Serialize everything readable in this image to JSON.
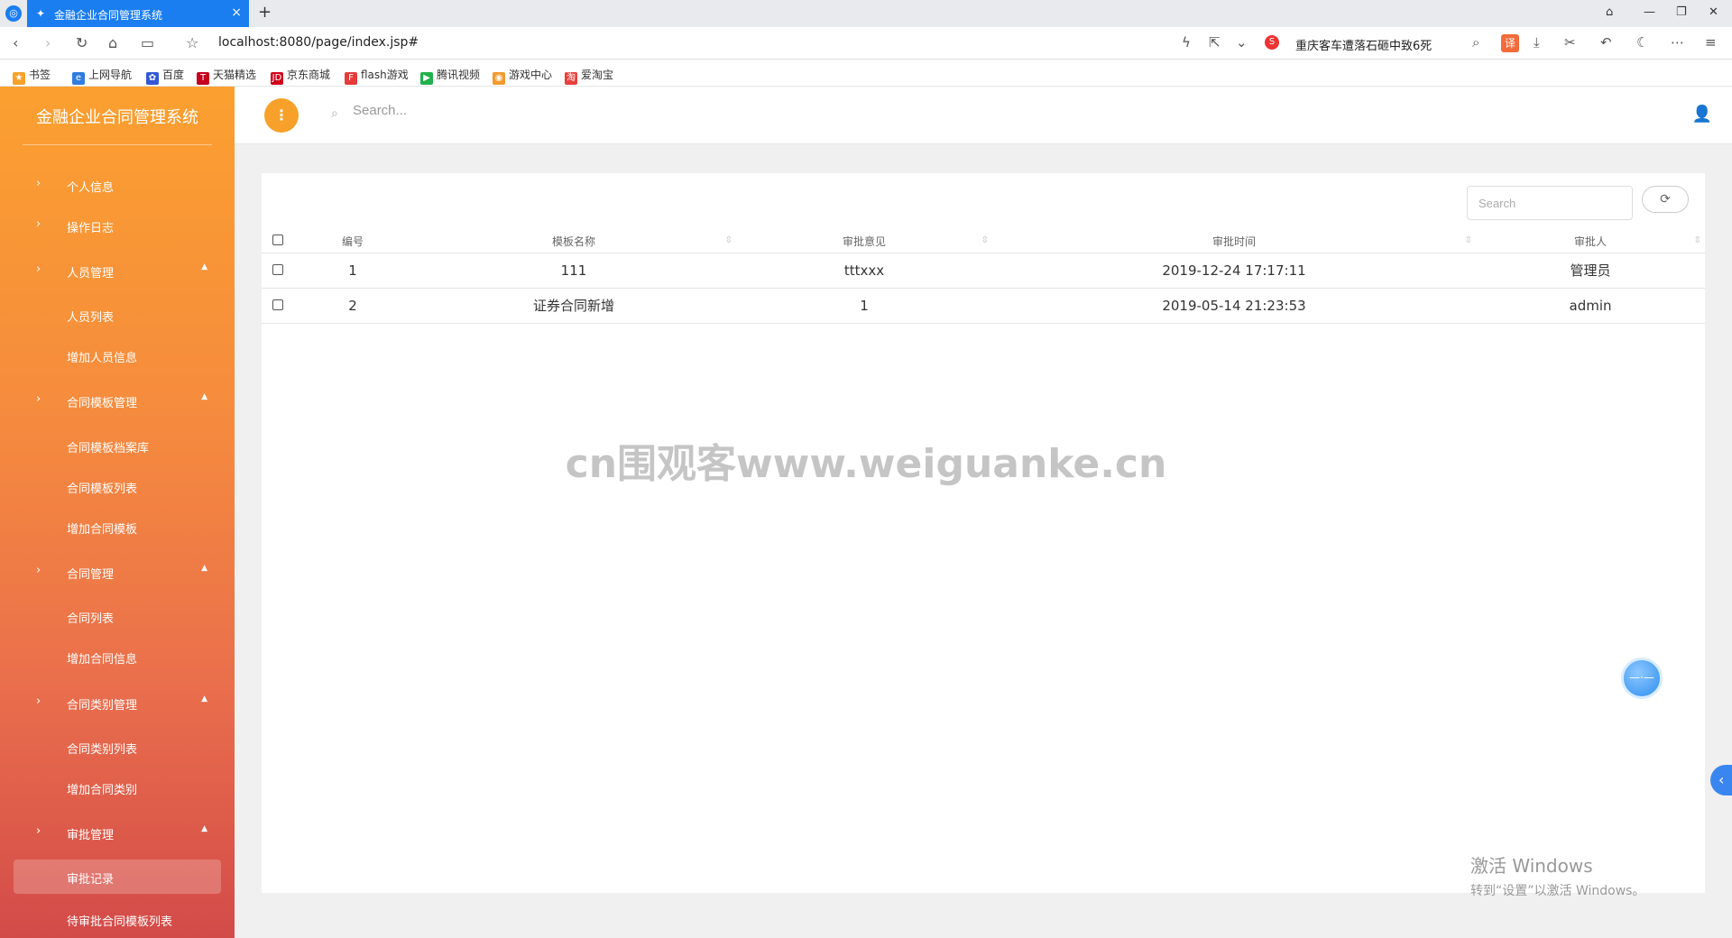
{
  "browser": {
    "tab_title": "金融企业合同管理系统",
    "tab_close": "×",
    "new_tab": "+",
    "url": "localhost:8080/page/index.jsp#",
    "news_headline": "重庆客车遭落石砸中致6死",
    "translate_label": "译",
    "bookmarks": [
      "书签",
      "上网导航",
      "百度",
      "天猫精选",
      "京东商城",
      "flash游戏",
      "腾讯视频",
      "游戏中心",
      "爱淘宝"
    ]
  },
  "sidebar": {
    "brand": "金融企业合同管理系统",
    "items": [
      {
        "label": "个人信息"
      },
      {
        "label": "操作日志"
      },
      {
        "label": "人员管理"
      },
      {
        "label": "人员列表"
      },
      {
        "label": "增加人员信息"
      },
      {
        "label": "合同模板管理"
      },
      {
        "label": "合同模板档案库"
      },
      {
        "label": "合同模板列表"
      },
      {
        "label": "增加合同模板"
      },
      {
        "label": "合同管理"
      },
      {
        "label": "合同列表"
      },
      {
        "label": "增加合同信息"
      },
      {
        "label": "合同类别管理"
      },
      {
        "label": "合同类别列表"
      },
      {
        "label": "增加合同类别"
      },
      {
        "label": "审批管理"
      },
      {
        "label": "审批记录"
      },
      {
        "label": "待审批合同模板列表"
      }
    ]
  },
  "topbar": {
    "search_placeholder": "Search..."
  },
  "table": {
    "search_placeholder": "Search",
    "columns": [
      "编号",
      "模板名称",
      "审批意见",
      "审批时间",
      "审批人"
    ],
    "rows": [
      {
        "id": "1",
        "template": "111",
        "opinion": "tttxxx",
        "time": "2019-12-24 17:17:11",
        "approver": "管理员"
      },
      {
        "id": "2",
        "template": "证券合同新增",
        "opinion": "1",
        "time": "2019-05-14 21:23:53",
        "approver": "admin"
      }
    ]
  },
  "overlay": {
    "watermark": "cn围观客www.weiguanke.cn",
    "activate_title": "激活 Windows",
    "activate_sub": "转到“设置”以激活 Windows。"
  },
  "colors": {
    "accent": "#f7a12a",
    "tab_blue": "#1a7df0"
  }
}
